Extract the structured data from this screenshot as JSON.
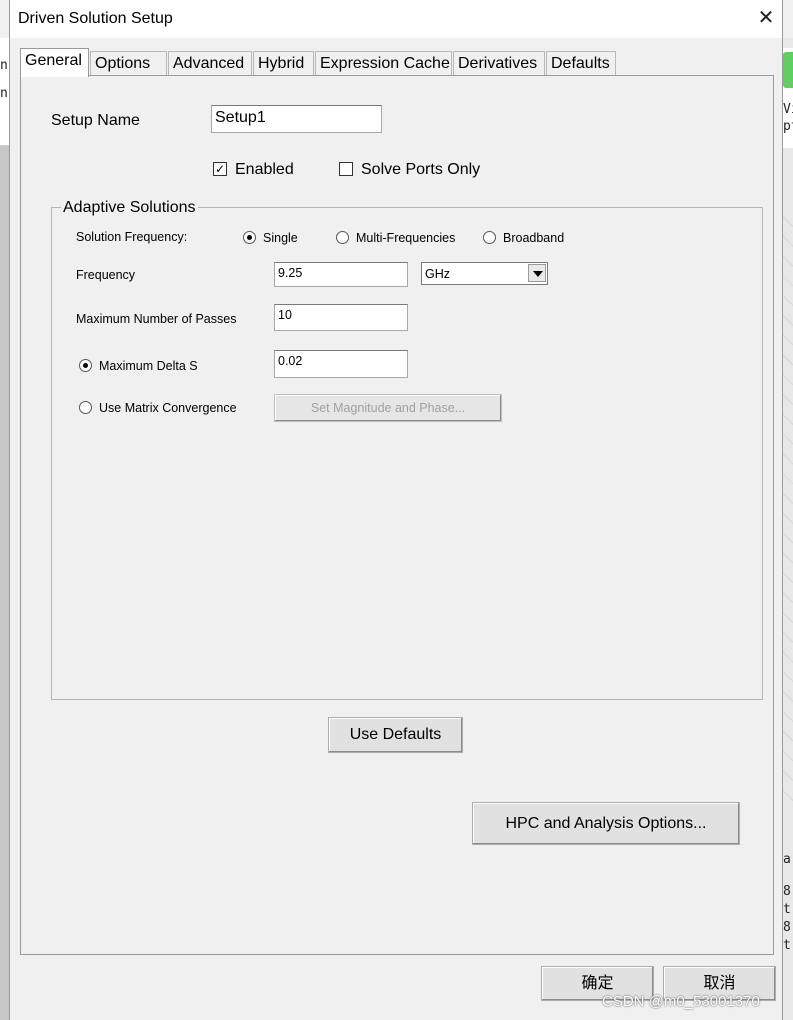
{
  "background": {
    "left_fragments": [
      "n",
      "n"
    ],
    "right_fragments_top": [
      "Vi",
      "pt"
    ],
    "right_fragments_bottom": [
      "a:",
      "8",
      "t",
      "8",
      "t"
    ]
  },
  "dialog": {
    "title": "Driven Solution Setup",
    "close_glyph": "✕"
  },
  "tabs": [
    "General",
    "Options",
    "Advanced",
    "Hybrid",
    "Expression Cache",
    "Derivatives",
    "Defaults"
  ],
  "general": {
    "setup_name_label": "Setup Name",
    "setup_name_value": "Setup1",
    "enabled_label": "Enabled",
    "enabled_checked": true,
    "solve_ports_only_label": "Solve Ports Only",
    "solve_ports_only_checked": false
  },
  "adaptive": {
    "group_title": "Adaptive Solutions",
    "solution_frequency_label": "Solution Frequency:",
    "options": [
      "Single",
      "Multi-Frequencies",
      "Broadband"
    ],
    "selected_option": "Single",
    "frequency_label": "Frequency",
    "frequency_value": "9.25",
    "frequency_unit": "GHz",
    "max_passes_label": "Maximum Number of Passes",
    "max_passes_value": "10",
    "max_delta_s_label": "Maximum Delta S",
    "max_delta_s_value": "0.02",
    "use_matrix_label": "Use Matrix Convergence",
    "set_magnitude_button": "Set Magnitude and Phase..."
  },
  "buttons": {
    "use_defaults": "Use Defaults",
    "hpc": "HPC and Analysis Options...",
    "ok": "确定",
    "cancel": "取消"
  },
  "watermark": "CSDN @m0_53001370"
}
